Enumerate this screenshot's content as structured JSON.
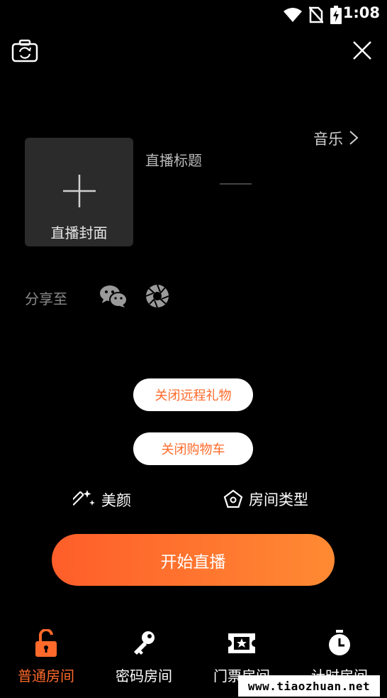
{
  "status_bar": {
    "time": "1:08",
    "icons": [
      "wifi-icon",
      "no-sim-icon",
      "battery-charging-icon"
    ]
  },
  "top": {
    "camera_icon": "camera-switch-icon",
    "close_icon": "close-icon"
  },
  "cover": {
    "label": "直播封面"
  },
  "title": {
    "label": "直播标题"
  },
  "music": {
    "label": "音乐"
  },
  "share": {
    "label": "分享至",
    "targets": [
      "wechat-icon",
      "moments-icon"
    ]
  },
  "buttons": {
    "remote_gift": "关闭远程礼物",
    "cart": "关闭购物车",
    "beauty": "美颜",
    "room_type": "房间类型",
    "start": "开始直播"
  },
  "tabs": [
    {
      "label": "普通房间",
      "icon": "unlock-icon",
      "active": true
    },
    {
      "label": "密码房间",
      "icon": "key-icon",
      "active": false
    },
    {
      "label": "门票房间",
      "icon": "ticket-icon",
      "active": false
    },
    {
      "label": "计时房间",
      "icon": "timer-icon",
      "active": false
    }
  ],
  "colors": {
    "accent": "#ff6a2a",
    "background": "#000000",
    "cover_bg": "#2b2b2b"
  },
  "watermark": "www.tiaozhuan.net"
}
